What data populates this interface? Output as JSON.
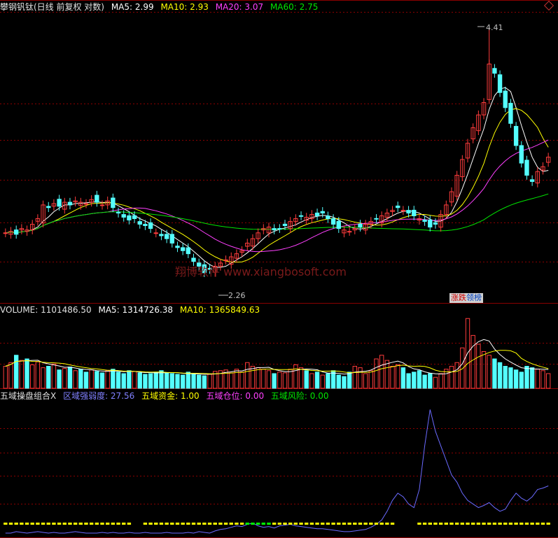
{
  "header": {
    "stock": "攀钢钒钛(日线 前复权 对数)",
    "ma5": "MA5: 2.99",
    "ma10": "MA10: 2.93",
    "ma20": "MA20: 3.07",
    "ma60": "MA60: 2.75"
  },
  "annotations": {
    "high": "4.41",
    "low": "2.26"
  },
  "badge": {
    "up": "涨跌",
    "rank": "领榜"
  },
  "watermark": "翔博软件 www.xiangbosoft.com",
  "volume": {
    "label": "VOLUME: 1101486.50",
    "ma5": "MA5: 1314726.38",
    "ma10": "MA10: 1365849.63"
  },
  "indicator": {
    "name": "五域操盘组合X",
    "strength": "区域强弱度: 27.56",
    "fund": "五域资金: 1.00",
    "position": "五域仓位: 0.00",
    "risk": "五域风险: 0.00"
  },
  "colors": {
    "up": "#ff3c3c",
    "down": "#54ffff",
    "ma5": "#ffffff",
    "ma10": "#ffff00",
    "ma20": "#ff40ff",
    "ma60": "#00e600",
    "indicator_line": "#6a6aff",
    "grid": "#8b0000",
    "fund_marker": "#ffff00",
    "risk_marker": "#00ff00"
  },
  "chart_data": {
    "type": "candlestick",
    "closes": [
      2.52,
      2.53,
      2.51,
      2.55,
      2.54,
      2.58,
      2.62,
      2.72,
      2.7,
      2.73,
      2.71,
      2.74,
      2.72,
      2.75,
      2.74,
      2.73,
      2.76,
      2.74,
      2.72,
      2.75,
      2.7,
      2.66,
      2.63,
      2.61,
      2.62,
      2.58,
      2.57,
      2.55,
      2.52,
      2.5,
      2.48,
      2.45,
      2.42,
      2.4,
      2.38,
      2.33,
      2.3,
      2.26,
      2.28,
      2.3,
      2.32,
      2.34,
      2.36,
      2.38,
      2.4,
      2.45,
      2.48,
      2.52,
      2.55,
      2.56,
      2.54,
      2.55,
      2.57,
      2.6,
      2.62,
      2.64,
      2.63,
      2.65,
      2.64,
      2.66,
      2.62,
      2.58,
      2.55,
      2.54,
      2.53,
      2.55,
      2.56,
      2.58,
      2.6,
      2.62,
      2.64,
      2.66,
      2.68,
      2.7,
      2.68,
      2.66,
      2.64,
      2.62,
      2.6,
      2.56,
      2.58,
      2.65,
      2.72,
      2.82,
      2.95,
      3.08,
      3.22,
      3.36,
      3.48,
      3.6,
      4.0,
      3.9,
      3.7,
      3.55,
      3.4,
      3.2,
      3.05,
      2.95,
      2.9,
      2.98,
      3.02,
      3.1
    ],
    "high_label": "4.41",
    "low_label": "2.26",
    "volume": [
      30,
      35,
      45,
      38,
      40,
      32,
      36,
      28,
      30,
      33,
      25,
      27,
      29,
      24,
      26,
      22,
      25,
      23,
      21,
      24,
      26,
      22,
      20,
      24,
      23,
      21,
      19,
      20,
      22,
      24,
      21,
      20,
      19,
      18,
      22,
      20,
      18,
      17,
      19,
      23,
      24,
      25,
      21,
      26,
      22,
      35,
      30,
      28,
      26,
      24,
      20,
      22,
      21,
      26,
      32,
      28,
      24,
      20,
      22,
      18,
      20,
      24,
      18,
      16,
      22,
      30,
      28,
      20,
      24,
      40,
      45,
      38,
      30,
      32,
      28,
      20,
      22,
      24,
      18,
      20,
      15,
      20,
      26,
      30,
      35,
      55,
      95,
      72,
      60,
      50,
      45,
      40,
      35,
      30,
      28,
      25,
      22,
      30,
      28,
      26,
      24,
      20
    ],
    "strength": [
      0,
      0,
      2,
      1,
      0,
      1,
      2,
      1,
      0,
      1,
      0,
      0,
      1,
      2,
      1,
      0,
      0,
      0,
      1,
      0,
      1,
      0,
      0,
      1,
      0,
      0,
      1,
      0,
      0,
      0,
      1,
      0,
      0,
      0,
      1,
      0,
      2,
      1,
      0,
      3,
      5,
      6,
      8,
      10,
      9,
      12,
      14,
      10,
      8,
      9,
      7,
      10,
      11,
      12,
      10,
      9,
      8,
      7,
      6,
      6,
      5,
      4,
      3,
      2,
      2,
      3,
      4,
      5,
      8,
      12,
      18,
      30,
      45,
      55,
      50,
      40,
      35,
      60,
      120,
      170,
      140,
      120,
      100,
      80,
      70,
      55,
      45,
      40,
      35,
      38,
      42,
      35,
      30,
      33,
      45,
      55,
      48,
      44,
      50,
      60,
      62,
      65
    ]
  }
}
